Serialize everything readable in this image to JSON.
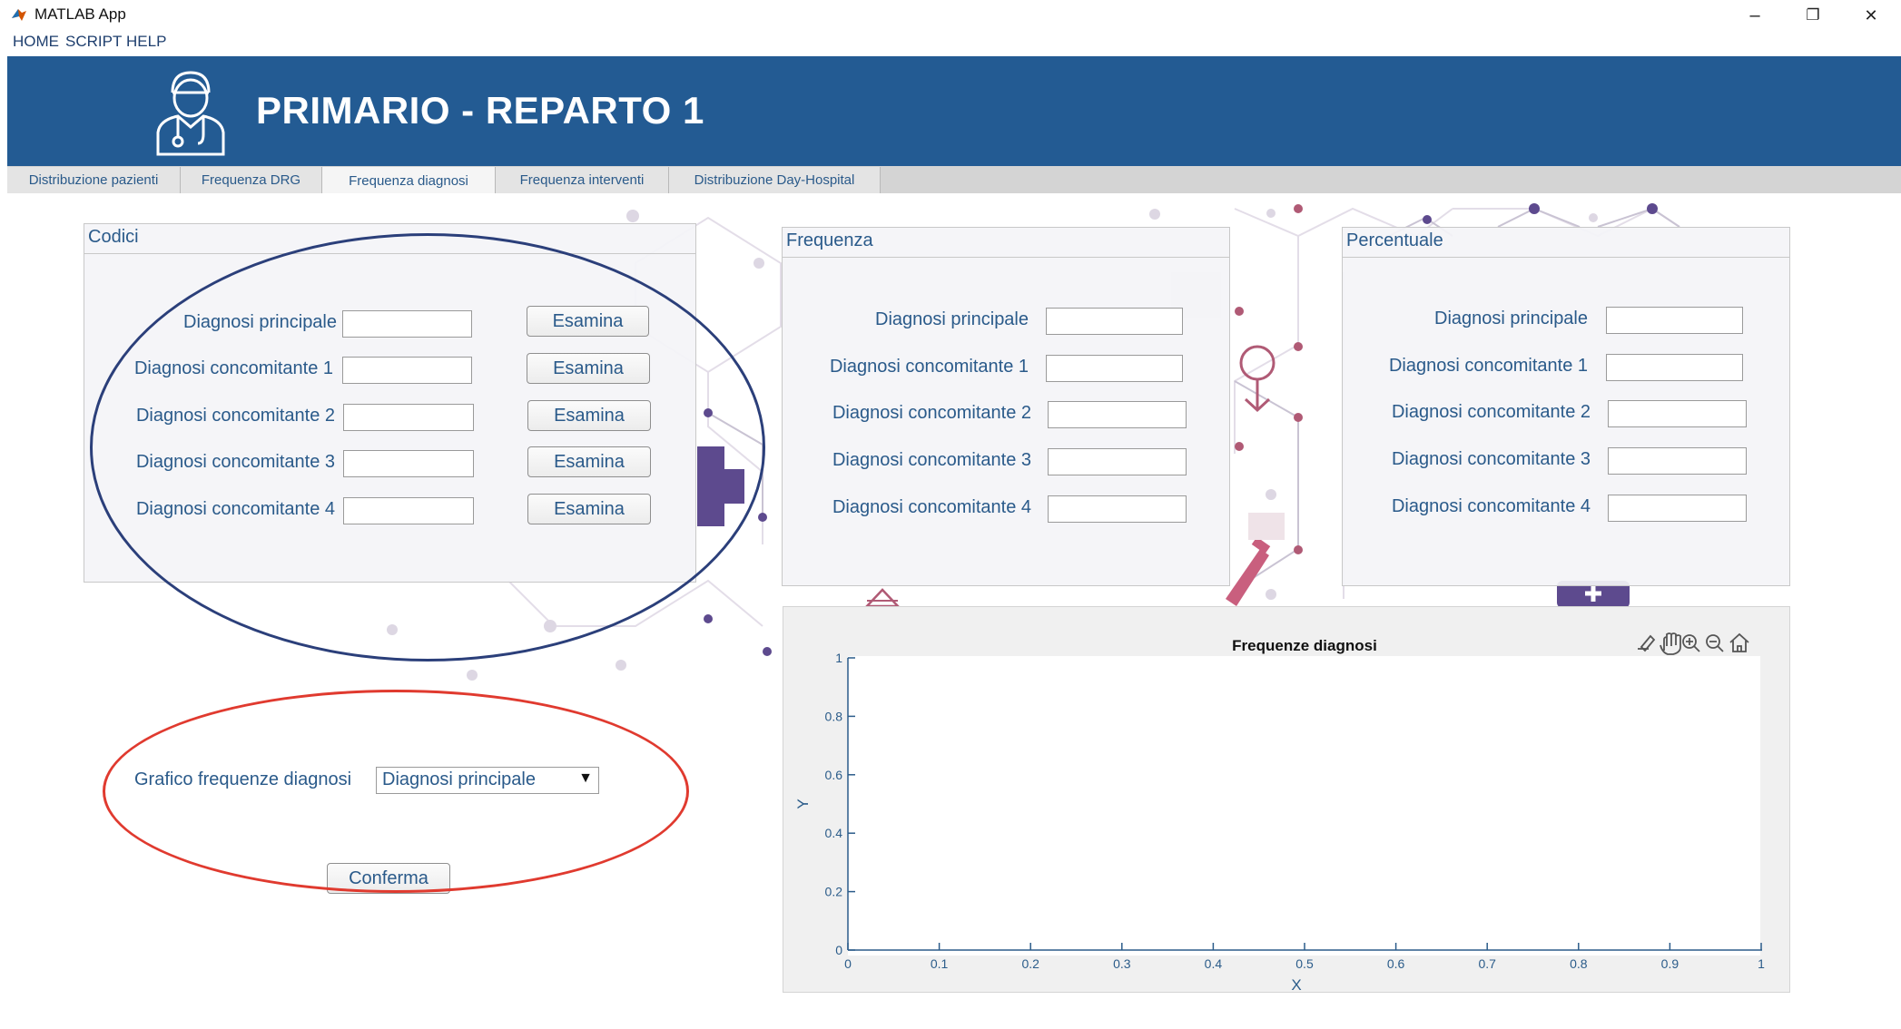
{
  "window": {
    "title": "MATLAB App",
    "minimize": "–",
    "restore": "❐",
    "close": "✕"
  },
  "menu": [
    "HOME",
    "SCRIPT",
    "HELP"
  ],
  "banner": {
    "title": "PRIMARIO - REPARTO 1",
    "icon": "doctor-icon",
    "color": "#235b93"
  },
  "tabs": [
    "Distribuzione pazienti",
    "Frequenza DRG",
    "Frequenza diagnosi",
    "Frequenza interventi",
    "Distribuzione Day-Hospital"
  ],
  "active_tab": "Frequenza diagnosi",
  "codici": {
    "title": "Codici",
    "rows": [
      "Diagnosi principale",
      "Diagnosi concomitante 1",
      "Diagnosi concomitante 2",
      "Diagnosi concomitante 3",
      "Diagnosi concomitante 4"
    ],
    "button_label": "Esamina"
  },
  "frequenza": {
    "title": "Frequenza",
    "rows": [
      "Diagnosi principale",
      "Diagnosi concomitante 1",
      "Diagnosi concomitante 2",
      "Diagnosi concomitante 3",
      "Diagnosi concomitante 4"
    ]
  },
  "percentuale": {
    "title": "Percentuale",
    "rows": [
      "Diagnosi principale",
      "Diagnosi concomitante 1",
      "Diagnosi concomitante 2",
      "Diagnosi concomitante 3",
      "Diagnosi concomitante 4"
    ]
  },
  "grafico": {
    "label": "Grafico frequenze diagnosi",
    "selected": "Diagnosi principale",
    "confirm": "Conferma"
  },
  "annotations": {
    "blue_ellipse": "#2b3f7a",
    "red_ellipse": "#e03a2f"
  },
  "axes_toolbar": [
    "brush-icon",
    "pan-icon",
    "zoom-in-icon",
    "zoom-out-icon",
    "home-icon"
  ],
  "chart_data": {
    "type": "line",
    "title": "Frequenze diagnosi",
    "xlabel": "X",
    "ylabel": "Y",
    "xlim": [
      0,
      1
    ],
    "ylim": [
      0,
      1
    ],
    "x_ticks": [
      "0",
      "0.1",
      "0.2",
      "0.3",
      "0.4",
      "0.5",
      "0.6",
      "0.7",
      "0.8",
      "0.9",
      "1"
    ],
    "y_ticks": [
      "0",
      "0.2",
      "0.4",
      "0.6",
      "0.8",
      "1"
    ],
    "series": []
  }
}
